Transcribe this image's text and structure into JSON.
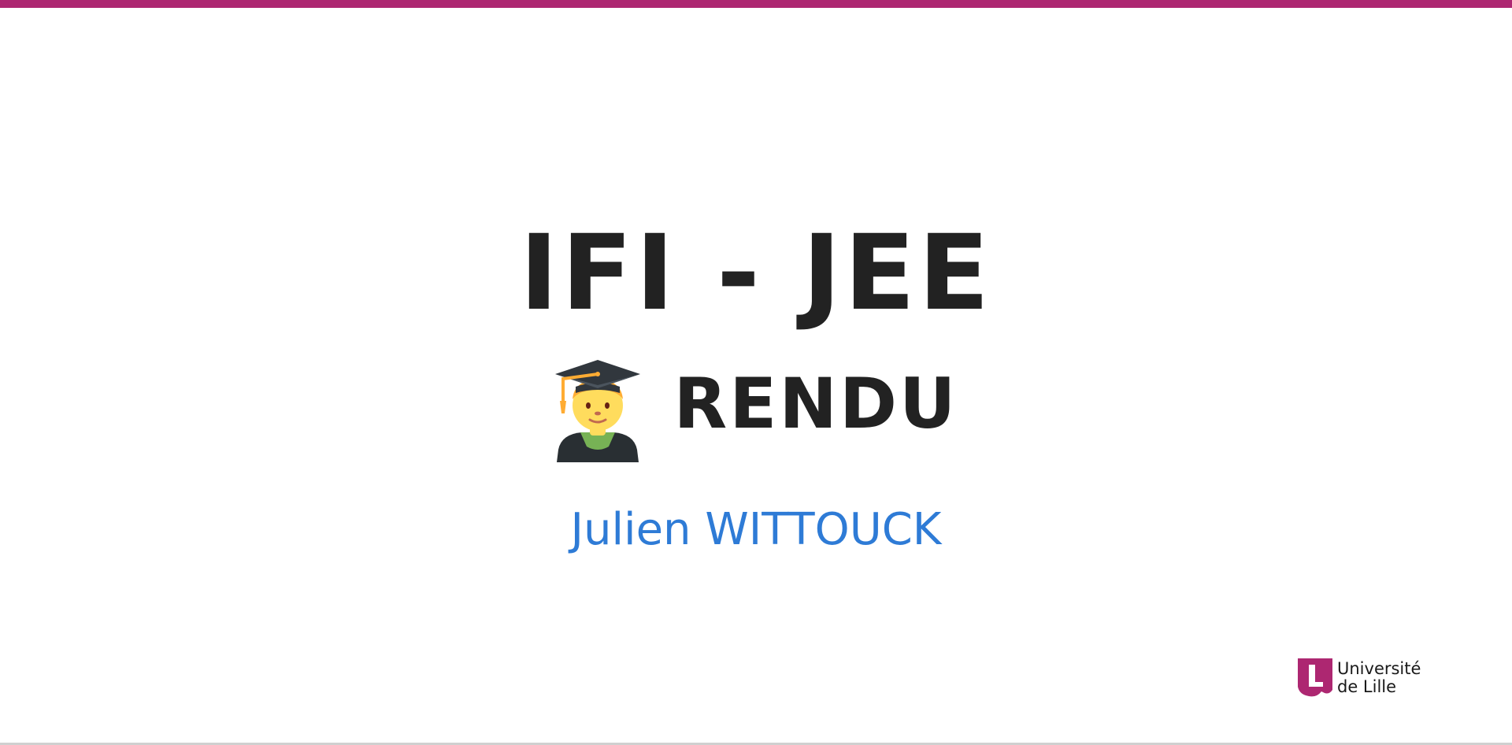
{
  "slide": {
    "title": "IFI - JEE",
    "subtitle": "RENDU",
    "subtitle_icon": "student-graduation-cap-icon",
    "author": "Julien WITTOUCK"
  },
  "logo": {
    "line1": "Université",
    "line2": "de Lille",
    "icon": "university-of-lille-logo-icon"
  },
  "colors": {
    "accent": "#ad2771",
    "title": "#222222",
    "author": "#2e7bd6",
    "bottom_rule": "#d0d0d0"
  }
}
